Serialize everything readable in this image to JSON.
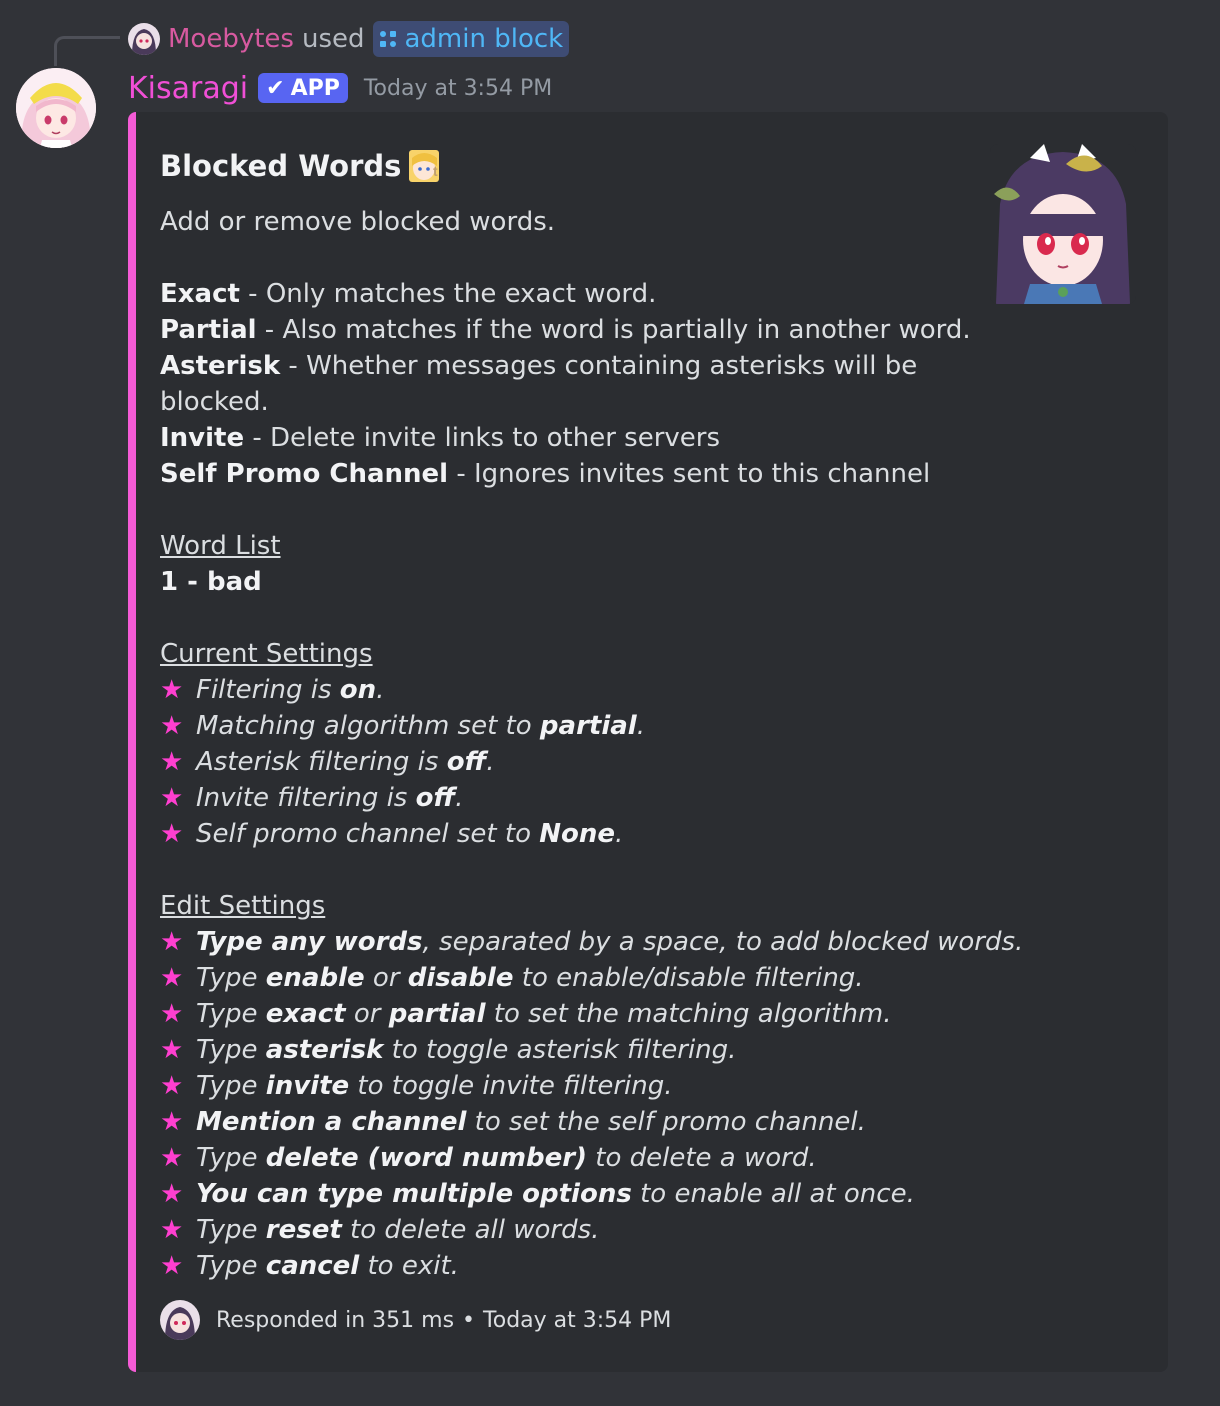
{
  "reply": {
    "username": "Moebytes",
    "used_text": "used",
    "command": "admin block"
  },
  "message": {
    "author": "Kisaragi",
    "badge": "APP",
    "timestamp": "Today at 3:54 PM"
  },
  "embed": {
    "accent_color": "#f45bd6",
    "title": "Blocked Words",
    "description": "Add or remove blocked words.",
    "definitions": [
      {
        "term": "Exact",
        "text": " - Only matches the exact word."
      },
      {
        "term": "Partial",
        "text": " - Also matches if the word is partially in another word."
      },
      {
        "term": "Asterisk",
        "text": " - Whether messages containing asterisks will be"
      },
      {
        "term": "",
        "text": "blocked."
      },
      {
        "term": "Invite",
        "text": " - Delete invite links to other servers"
      },
      {
        "term": "Self Promo Channel",
        "text": " - Ignores invites sent to this channel"
      }
    ],
    "word_list_heading": "Word List",
    "word_list": [
      "1 - bad"
    ],
    "current_settings_heading": "Current Settings",
    "current_settings": [
      {
        "pre": "Filtering is ",
        "bold": "on",
        "post": "."
      },
      {
        "pre": "Matching algorithm set to ",
        "bold": "partial",
        "post": "."
      },
      {
        "pre": "Asterisk filtering is ",
        "bold": "off",
        "post": "."
      },
      {
        "pre": "Invite filtering is ",
        "bold": "off",
        "post": "."
      },
      {
        "pre": "Self promo channel set to ",
        "bold": "None",
        "post": "."
      }
    ],
    "edit_settings_heading": "Edit Settings",
    "edit_settings": [
      {
        "parts": [
          {
            "b": "Type any words"
          },
          {
            "t": ", separated by a space, to add blocked words."
          }
        ]
      },
      {
        "parts": [
          {
            "t": "Type "
          },
          {
            "b": "enable"
          },
          {
            "t": " or "
          },
          {
            "b": "disable"
          },
          {
            "t": " to enable/disable filtering."
          }
        ]
      },
      {
        "parts": [
          {
            "t": "Type "
          },
          {
            "b": "exact"
          },
          {
            "t": " or "
          },
          {
            "b": "partial"
          },
          {
            "t": " to set the matching algorithm."
          }
        ]
      },
      {
        "parts": [
          {
            "t": "Type "
          },
          {
            "b": "asterisk"
          },
          {
            "t": " to toggle asterisk filtering."
          }
        ]
      },
      {
        "parts": [
          {
            "t": "Type "
          },
          {
            "b": "invite"
          },
          {
            "t": " to toggle invite filtering."
          }
        ]
      },
      {
        "parts": [
          {
            "b": "Mention a channel"
          },
          {
            "t": " to set the self promo channel."
          }
        ]
      },
      {
        "parts": [
          {
            "t": "Type "
          },
          {
            "b": "delete (word number)"
          },
          {
            "t": " to delete a word."
          }
        ]
      },
      {
        "parts": [
          {
            "b": "You can type multiple options"
          },
          {
            "t": " to enable all at once."
          }
        ]
      },
      {
        "parts": [
          {
            "t": "Type "
          },
          {
            "b": "reset"
          },
          {
            "t": " to delete all words."
          }
        ]
      },
      {
        "parts": [
          {
            "t": "Type "
          },
          {
            "b": "cancel"
          },
          {
            "t": " to exit."
          }
        ]
      }
    ],
    "star_icon": "pink-star-icon",
    "footer": {
      "text": "Responded in 351 ms",
      "separator": "•",
      "timestamp": "Today at 3:54 PM"
    }
  }
}
